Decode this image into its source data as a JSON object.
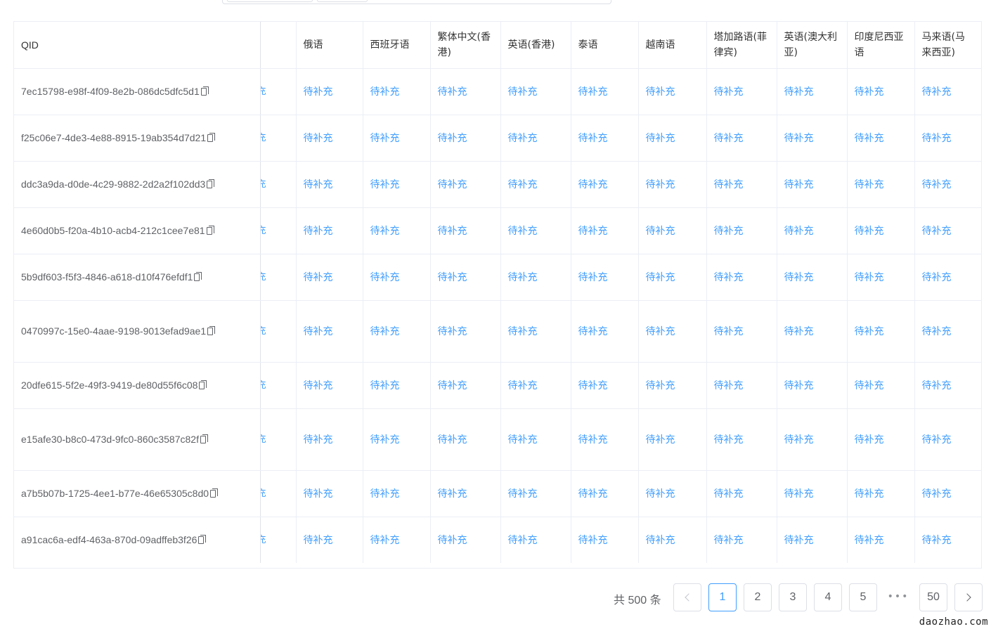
{
  "table": {
    "headers": {
      "qid": "QID",
      "cut": "",
      "ru": "俄语",
      "es": "西班牙语",
      "tw": "繁体中文(香港)",
      "hk": "英语(香港)",
      "th": "泰语",
      "vi": "越南语",
      "tl": "塔加路语(菲律宾)",
      "au": "英语(澳大利亚)",
      "id": "印度尼西亚语",
      "my": "马来语(马来西亚)"
    },
    "cut_glyph": "充",
    "cell_value": "待补充",
    "rows": [
      {
        "qid": "7ec15798-e98f-4f09-8e2b-086dc5dfc5d1",
        "tall": false
      },
      {
        "qid": "f25c06e7-4de3-4e88-8915-19ab354d7d21",
        "tall": false
      },
      {
        "qid": "ddc3a9da-d0de-4c29-9882-2d2a2f102dd3",
        "tall": false
      },
      {
        "qid": "4e60d0b5-f20a-4b10-acb4-212c1cee7e81",
        "tall": false
      },
      {
        "qid": "5b9df603-f5f3-4846-a618-d10f476efdf1",
        "tall": false
      },
      {
        "qid": "0470997c-15e0-4aae-9198-9013efad9ae1",
        "tall": true
      },
      {
        "qid": "20dfe615-5f2e-49f3-9419-de80d55f6c08",
        "tall": false
      },
      {
        "qid": "e15afe30-b8c0-473d-9fc0-860c3587c82f",
        "tall": true
      },
      {
        "qid": "a7b5b07b-1725-4ee1-b77e-46e65305c8d0",
        "tall": false
      },
      {
        "qid": "a91cac6a-edf4-463a-870d-09adffeb3f26",
        "tall": false
      }
    ]
  },
  "pagination": {
    "total_text": "共 500 条",
    "pages": [
      "1",
      "2",
      "3",
      "4",
      "5"
    ],
    "active_page": "1",
    "ellipsis": "•••",
    "last_page": "50"
  },
  "watermark": "daozhao.com",
  "colors": {
    "link": "#409eff",
    "border": "#ebeef5",
    "text": "#333333"
  }
}
